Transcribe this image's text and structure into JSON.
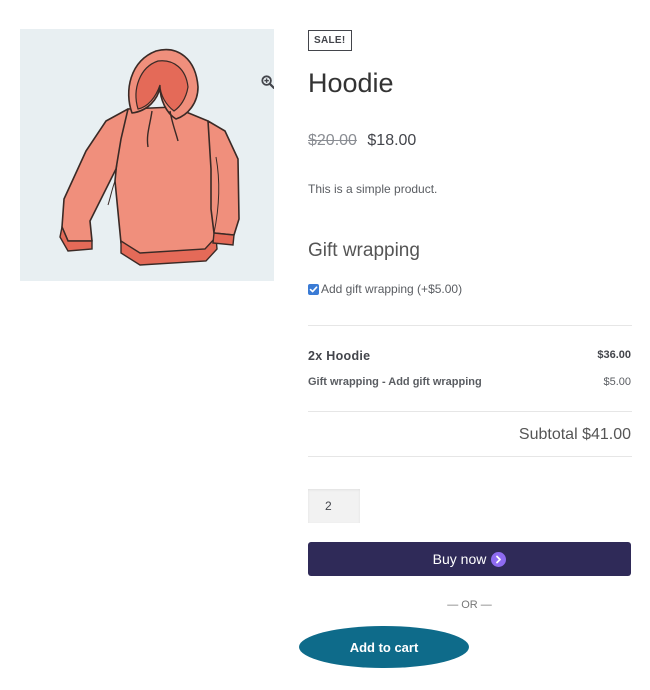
{
  "product": {
    "sale_badge": "SALE!",
    "title": "Hoodie",
    "regular_price": "$20.00",
    "sale_price": "$18.00",
    "description": "This is a simple product.",
    "image_icon": "hoodie-illustration"
  },
  "gallery": {
    "zoom_icon": "magnify-plus-icon"
  },
  "gift_wrapping": {
    "heading": "Gift wrapping",
    "option_label": "Add gift wrapping (+$5.00)",
    "checked": true
  },
  "summary": {
    "lines": [
      {
        "name": "2x Hoodie",
        "amount": "$36.00"
      },
      {
        "name": "Gift wrapping - Add gift wrapping",
        "amount": "$5.00"
      }
    ],
    "subtotal": "Subtotal $41.00"
  },
  "cart": {
    "quantity": "2",
    "buy_now_label": "Buy now",
    "buy_now_icon": "chevron-right-circle-icon",
    "separator": "— OR —",
    "add_to_cart_label": "Add to cart"
  },
  "colors": {
    "buy_now_bg": "#2f2a58",
    "buy_now_icon": "#8e6bf1",
    "add_to_cart_bg": "#0e6b8a",
    "checkbox": "#3a7bd5",
    "hoodie": "#f08f7c",
    "image_bg": "#e8eff2"
  }
}
